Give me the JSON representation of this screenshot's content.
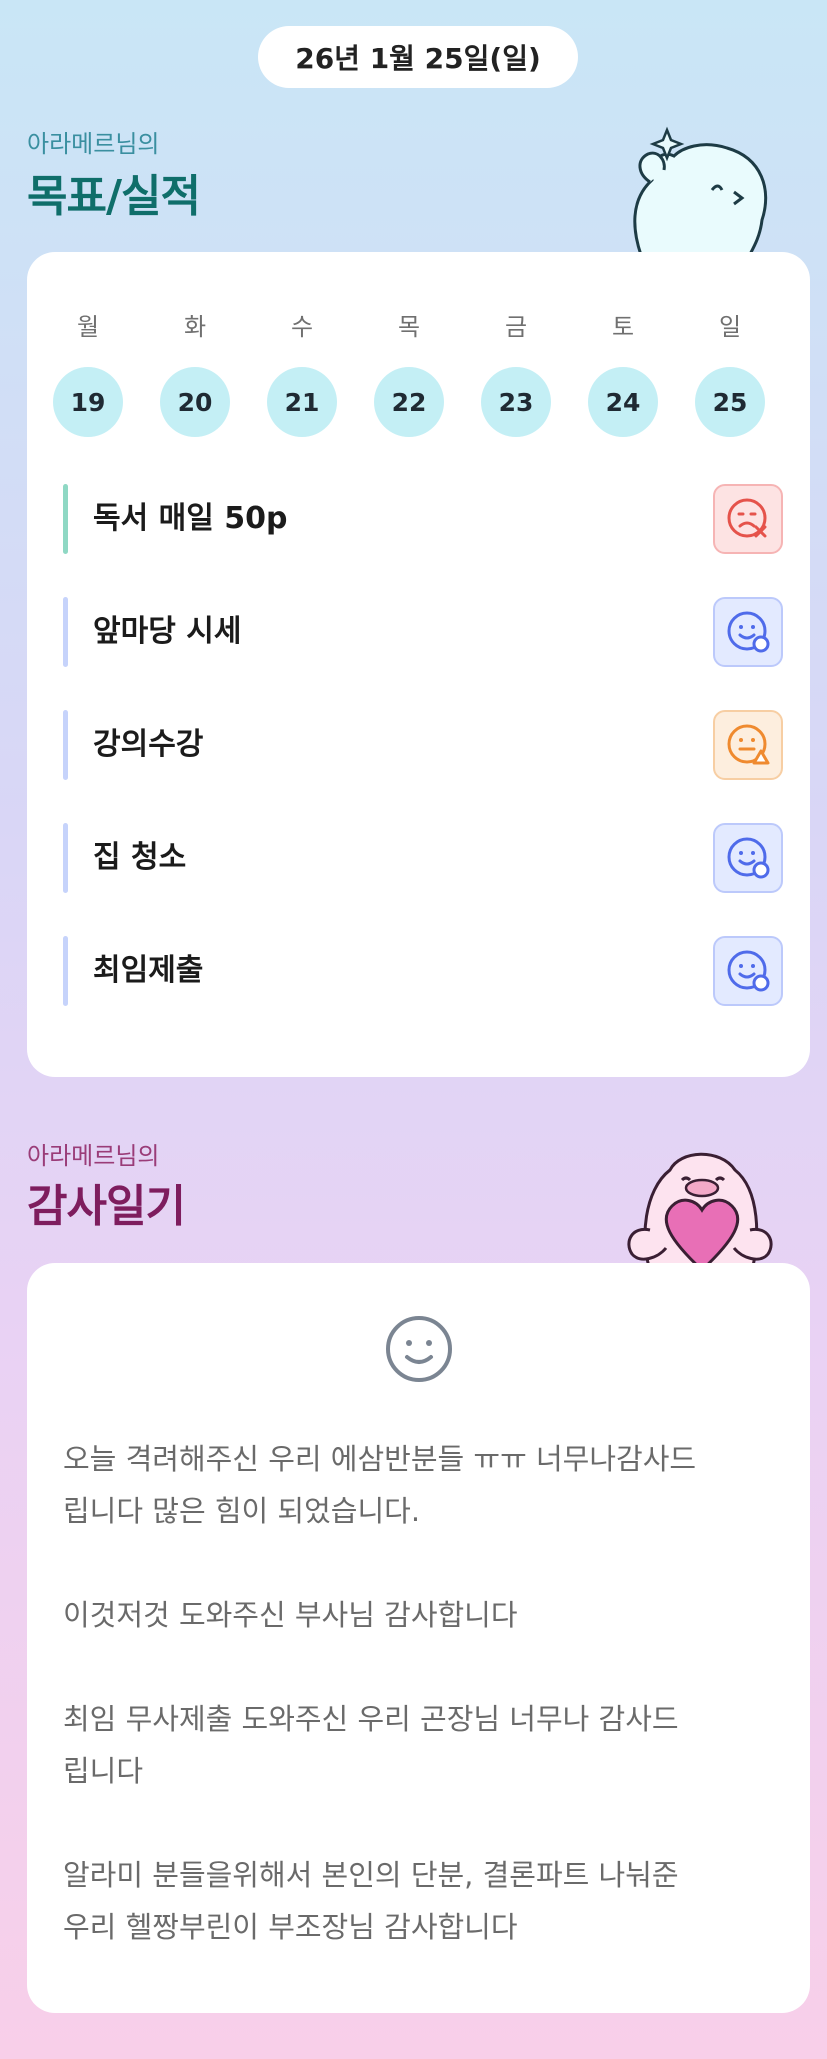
{
  "header": {
    "date": "26년 1월 25일(일)"
  },
  "goals_section": {
    "subtitle": "아라메르님의",
    "title": "목표/실적"
  },
  "week": {
    "days": [
      {
        "label": "월",
        "num": "19"
      },
      {
        "label": "화",
        "num": "20"
      },
      {
        "label": "수",
        "num": "21"
      },
      {
        "label": "목",
        "num": "22"
      },
      {
        "label": "금",
        "num": "23"
      },
      {
        "label": "토",
        "num": "24"
      },
      {
        "label": "일",
        "num": "25"
      }
    ]
  },
  "goals": [
    {
      "text": "독서 매일 50p",
      "status": "failed",
      "bar_color": "#8fd8c4",
      "icon": "sad-face-x-icon"
    },
    {
      "text": "앞마당 시세",
      "status": "done",
      "bar_color": "#c6d3fb",
      "icon": "happy-face-check-icon"
    },
    {
      "text": "강의수강",
      "status": "partial",
      "bar_color": "#c6d3fb",
      "icon": "neutral-face-triangle-icon"
    },
    {
      "text": "집 청소",
      "status": "done",
      "bar_color": "#c6d3fb",
      "icon": "happy-face-check-icon"
    },
    {
      "text": "최임제출",
      "status": "done",
      "bar_color": "#c6d3fb",
      "icon": "happy-face-check-icon"
    }
  ],
  "thanks_section": {
    "subtitle": "아라메르님의",
    "title": "감사일기"
  },
  "thanks_diary": {
    "mood_icon": "smile-face-icon",
    "text": "오늘 격려해주신 우리 에삼반분들 ㅠㅠ 너무나감사드\n립니다 많은 힘이 되었습니다.\n\n이것저것 도와주신 부사님 감사합니다\n\n최임 무사제출 도와주신 우리 곤장님 너무나 감사드\n립니다\n\n알라미 분들을위해서 본인의 단분, 결론파트 나눠준\n우리 헬짱부린이 부조장님 감사합니다"
  },
  "colors": {
    "goal_title": "#0f6e6a",
    "thanks_title": "#7e1d5e",
    "day_circle": "#c4eff5",
    "status_failed": "#e5534b",
    "status_done": "#4f6bea",
    "status_partial": "#ef8a2f"
  }
}
